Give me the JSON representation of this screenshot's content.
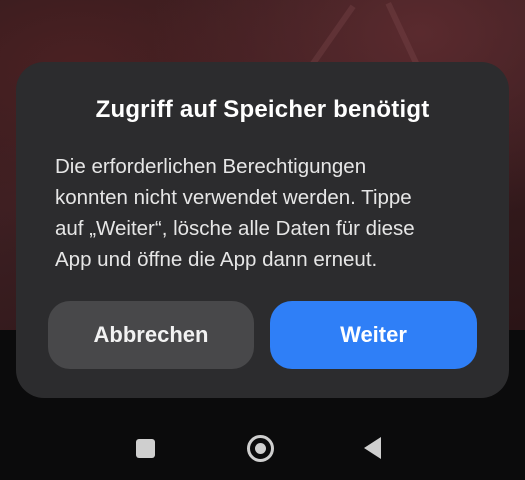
{
  "dialog": {
    "title": "Zugriff auf Speicher benötigt",
    "message_lines": [
      "Die erforderlichen Berechtigungen",
      "konnten nicht verwendet werden. Tippe",
      "auf „Weiter“, lösche alle Daten für diese",
      "App und öffne die App dann erneut."
    ],
    "cancel_label": "Abbrechen",
    "continue_label": "Weiter"
  },
  "navigation_bar": {
    "icons": [
      "recent-apps-icon",
      "home-icon",
      "back-icon"
    ]
  },
  "colors": {
    "dialog_background": "#2c2c2e",
    "primary_button": "#2f7ff7",
    "secondary_button": "#48484a",
    "nav_icons": "#cfcfcf"
  }
}
